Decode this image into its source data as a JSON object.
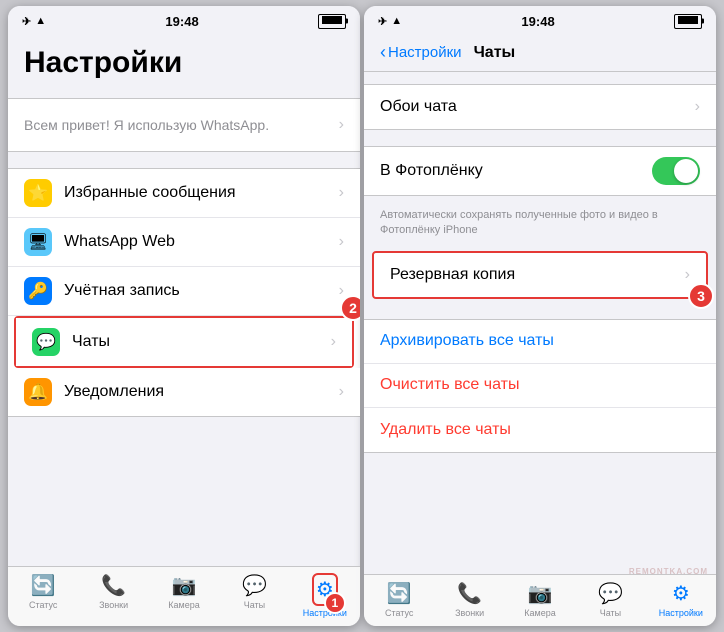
{
  "phone1": {
    "statusBar": {
      "airplaneMode": "✈",
      "wifi": "wifi",
      "time": "19:48",
      "battery": "🔋"
    },
    "pageTitle": "Настройки",
    "profileItem": {
      "text": "Всем привет! Я использую WhatsApp."
    },
    "menuItems": [
      {
        "id": "favorites",
        "icon": "⭐",
        "iconBg": "#ffcc00",
        "label": "Избранные сообщения"
      },
      {
        "id": "whatsapp-web",
        "icon": "🖥",
        "iconBg": "#5ac8fa",
        "label": "WhatsApp Web"
      },
      {
        "id": "account",
        "icon": "🔑",
        "iconBg": "#007aff",
        "label": "Учётная запись"
      },
      {
        "id": "chats",
        "icon": "💬",
        "iconBg": "#25d366",
        "label": "Чаты"
      },
      {
        "id": "notifications",
        "icon": "🔔",
        "iconBg": "#ff9500",
        "label": "Уведомления"
      }
    ],
    "tabBar": [
      {
        "id": "status",
        "icon": "○",
        "label": "Статус",
        "active": false
      },
      {
        "id": "calls",
        "icon": "☎",
        "label": "Звонки",
        "active": false
      },
      {
        "id": "camera",
        "icon": "📷",
        "label": "Камера",
        "active": false
      },
      {
        "id": "chats",
        "icon": "💬",
        "label": "Чаты",
        "active": false
      },
      {
        "id": "settings",
        "icon": "⚙",
        "label": "Настройки",
        "active": true
      }
    ],
    "steps": {
      "step1Label": "1",
      "step2Label": "2"
    }
  },
  "phone2": {
    "statusBar": {
      "time": "19:48"
    },
    "navBack": "Настройки",
    "navTitle": "Чаты",
    "sections": [
      {
        "items": [
          {
            "id": "wallpaper",
            "label": "Обои чата",
            "hasChevron": true
          }
        ]
      },
      {
        "items": [
          {
            "id": "save-to-camera",
            "label": "В Фотоплёнку",
            "hasToggle": true,
            "toggleOn": true
          }
        ],
        "desc": "Автоматически сохранять полученные фото и видео в Фотоплёнку iPhone"
      },
      {
        "items": [
          {
            "id": "backup",
            "label": "Резервная копия",
            "hasChevron": true,
            "highlighted": true
          }
        ]
      },
      {
        "items": [
          {
            "id": "archive-all",
            "label": "Архивировать все чаты",
            "isBlue": true
          },
          {
            "id": "clear-all",
            "label": "Очистить все чаты",
            "isRed": true
          },
          {
            "id": "delete-all",
            "label": "Удалить все чаты",
            "isRed": true
          }
        ]
      }
    ],
    "tabBar": [
      {
        "id": "status",
        "icon": "○",
        "label": "Статус",
        "active": false
      },
      {
        "id": "calls",
        "icon": "☎",
        "label": "Звонки",
        "active": false
      },
      {
        "id": "camera",
        "icon": "📷",
        "label": "Камера",
        "active": false
      },
      {
        "id": "chats",
        "icon": "💬",
        "label": "Чаты",
        "active": false
      },
      {
        "id": "settings",
        "icon": "⚙",
        "label": "Настройки",
        "active": true
      }
    ],
    "steps": {
      "step3Label": "3"
    }
  }
}
